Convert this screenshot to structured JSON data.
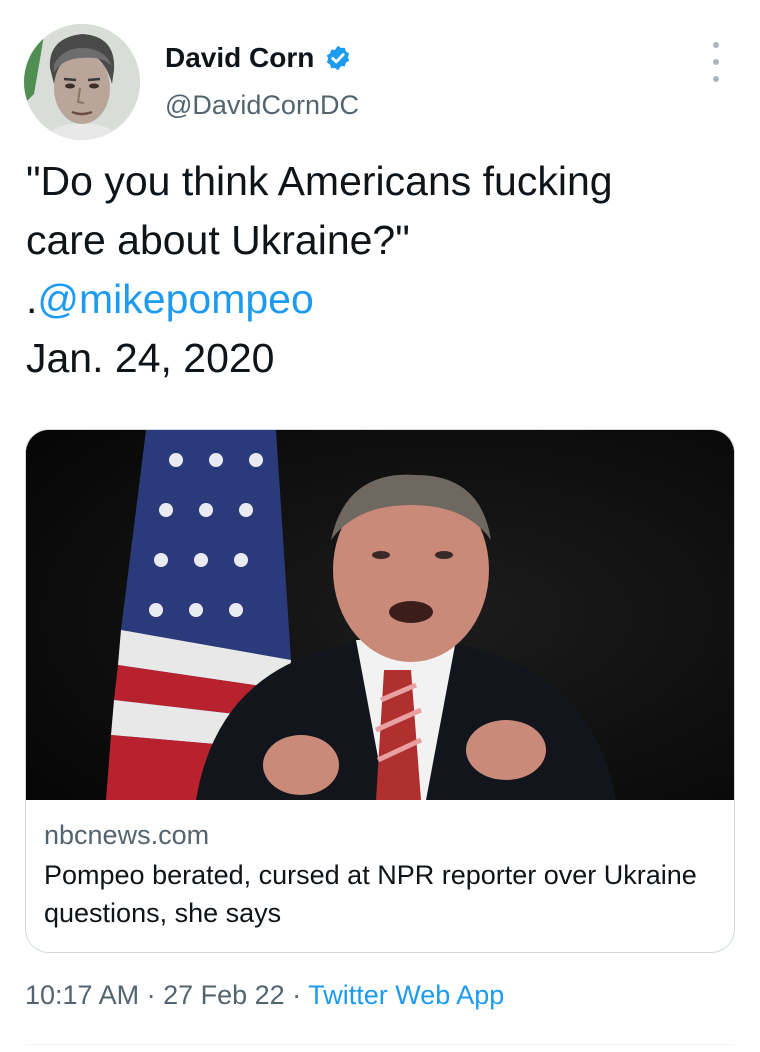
{
  "author": {
    "display_name": "David Corn",
    "handle": "@DavidCornDC",
    "verified": true,
    "avatar_icon": "avatar-portrait-icon"
  },
  "menu_icon": "more-options-icon",
  "tweet": {
    "line1": "\"Do you think Americans fucking",
    "line2": "care about Ukraine?\"",
    "mention_prefix": ".",
    "mention": "@mikepompeo",
    "date_line": "Jan. 24, 2020"
  },
  "card": {
    "image_icon": "news-photo-icon",
    "domain": "nbcnews.com",
    "title": "Pompeo berated, cursed at NPR reporter over Ukraine questions, she says"
  },
  "meta": {
    "time": "10:17 AM",
    "sep1": " · ",
    "date": "27 Feb 22",
    "sep2": " · ",
    "source": "Twitter Web App"
  },
  "colors": {
    "link": "#1d9bf0",
    "secondary_text": "#536471",
    "primary_text": "#0f1419",
    "border": "#cfd9de"
  }
}
